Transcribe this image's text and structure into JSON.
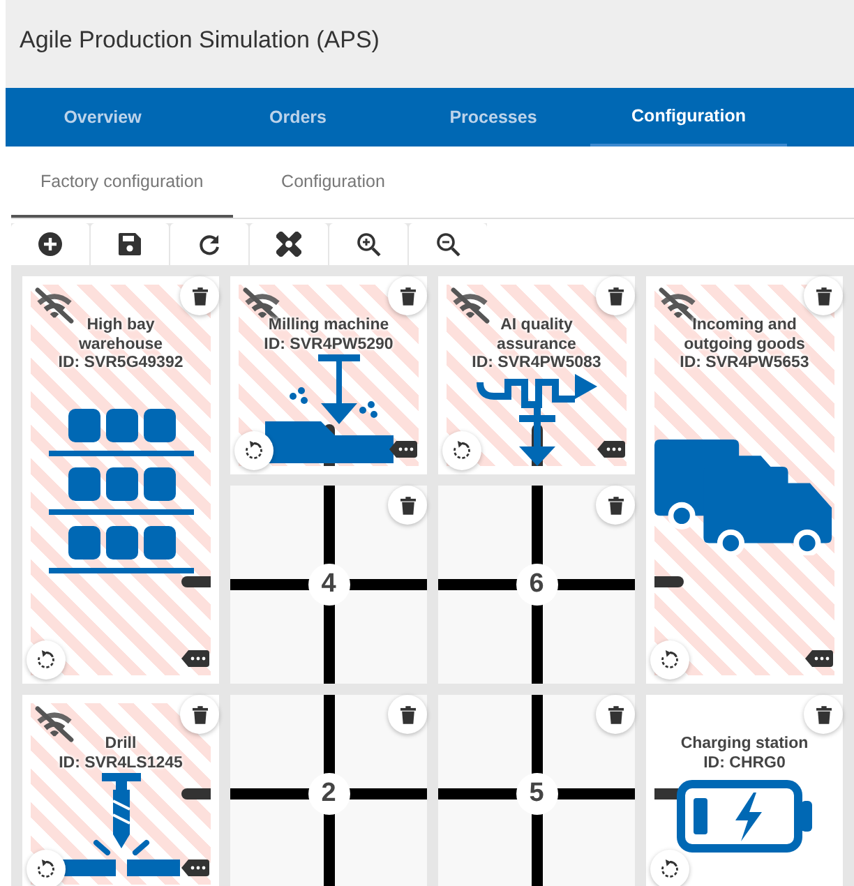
{
  "app": {
    "title": "Agile Production Simulation (APS)"
  },
  "nav_tabs": [
    {
      "label": "Overview",
      "selected": false
    },
    {
      "label": "Orders",
      "selected": false
    },
    {
      "label": "Processes",
      "selected": false
    },
    {
      "label": "Configuration",
      "selected": true
    }
  ],
  "sub_tabs": [
    {
      "label": "Factory configuration",
      "selected": true
    },
    {
      "label": "Configuration",
      "selected": false
    }
  ],
  "grid": {
    "cells": [
      {
        "kind": "warehouse",
        "title": "High bay warehouse",
        "id": "ID: SVR5G49392",
        "offline": true,
        "tall": true,
        "road_left": false,
        "road_right": true,
        "road_bottom": false
      },
      {
        "kind": "mill",
        "title": "Milling machine",
        "id": "ID: SVR4PW5290",
        "offline": true,
        "tall": false,
        "road_left": false,
        "road_right": false,
        "road_bottom": true
      },
      {
        "kind": "quality",
        "title": "AI quality assurance",
        "id": "ID: SVR4PW5083",
        "offline": true,
        "tall": false,
        "road_left": false,
        "road_right": false,
        "road_bottom": true
      },
      {
        "kind": "goods",
        "title": "Incoming and outgoing goods",
        "id": "ID: SVR4PW5653",
        "offline": true,
        "tall": true,
        "road_left": true,
        "road_right": false,
        "road_bottom": false
      },
      {
        "kind": "road",
        "number": "4"
      },
      {
        "kind": "road",
        "number": "6"
      },
      {
        "kind": "drill",
        "title": "Drill",
        "id": "ID: SVR4LS1245",
        "offline": true,
        "tall": false,
        "road_left": false,
        "road_right": true,
        "road_bottom": false
      },
      {
        "kind": "road",
        "number": "2"
      },
      {
        "kind": "road",
        "number": "5"
      },
      {
        "kind": "charger",
        "title": "Charging station",
        "id": "ID: CHRG0",
        "offline": false,
        "tall": false,
        "road_left": true,
        "road_right": false,
        "road_bottom": false
      }
    ]
  }
}
